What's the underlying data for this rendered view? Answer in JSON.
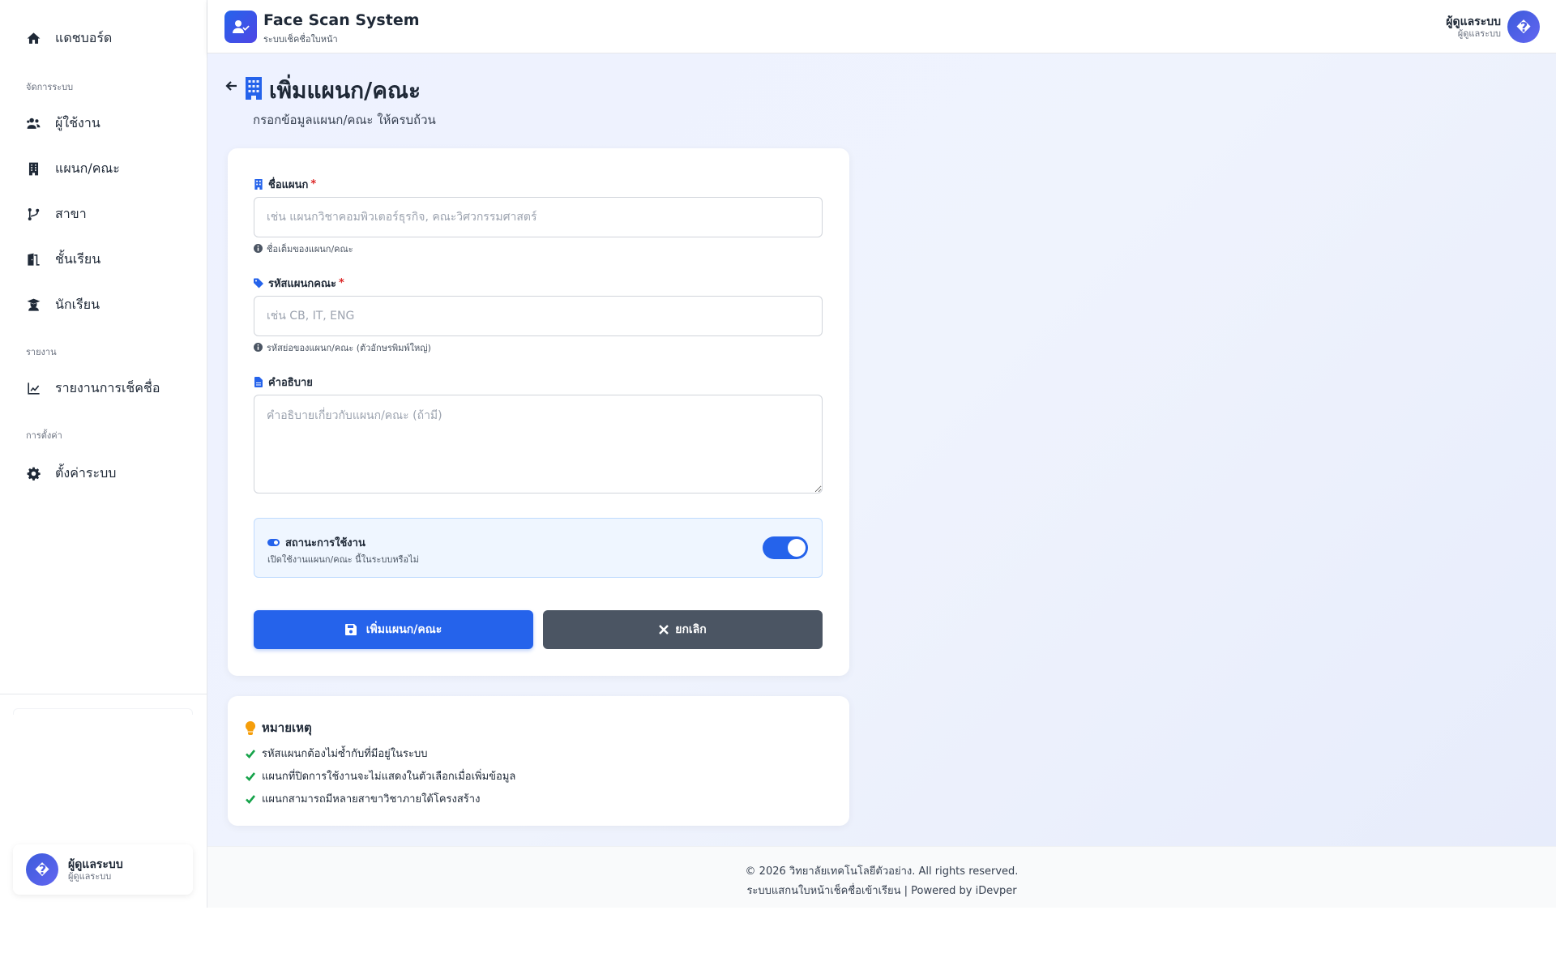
{
  "sidebar": {
    "items": [
      {
        "label": "แดชบอร์ด",
        "icon": "home-icon"
      },
      {
        "label": "ผู้ใช้งาน",
        "icon": "users-icon"
      },
      {
        "label": "แผนก/คณะ",
        "icon": "building-icon"
      },
      {
        "label": "สาขา",
        "icon": "branch-icon"
      },
      {
        "label": "ชั้นเรียน",
        "icon": "door-icon"
      },
      {
        "label": "นักเรียน",
        "icon": "graduate-icon"
      },
      {
        "label": "รายงานการเช็คชื่อ",
        "icon": "chart-line-icon"
      },
      {
        "label": "ตั้งค่าระบบ",
        "icon": "gear-icon"
      }
    ],
    "sections": {
      "manage": "จัดการระบบ",
      "reports": "รายงาน",
      "settings": "การตั้งค่า"
    },
    "user": {
      "avatar": "�",
      "name": "ผู้ดูแลระบบ",
      "role": "ผู้ดูแลระบบ"
    }
  },
  "header": {
    "title": "Face Scan System",
    "subtitle": "ระบบเช็คชื่อใบหน้า",
    "user": {
      "avatar": "�",
      "name": "ผู้ดูแลระบบ",
      "role": "ผู้ดูแลระบบ"
    }
  },
  "page": {
    "title": "เพิ่มแผนก/คณะ",
    "subtitle": "กรอกข้อมูลแผนก/คณะ ให้ครบถ้วน"
  },
  "form": {
    "name": {
      "label": "ชื่อแผนก",
      "required": "*",
      "placeholder": "เช่น แผนกวิชาคอมพิวเตอร์ธุรกิจ, คณะวิศวกรรมศาสตร์",
      "value": "",
      "hint": "ชื่อเต็มของแผนก/คณะ"
    },
    "code": {
      "label": "รหัสแผนกคณะ",
      "required": "*",
      "placeholder": "เช่น CB, IT, ENG",
      "value": "",
      "hint": "รหัสย่อของแผนก/คณะ (ตัวอักษรพิมพ์ใหญ่)"
    },
    "description": {
      "label": "คำอธิบาย",
      "placeholder": "คำอธิบายเกี่ยวกับแผนก/คณะ (ถ้ามี)",
      "value": ""
    },
    "status": {
      "label": "สถานะการใช้งาน",
      "description": "เปิดใช้งานแผนก/คณะ นี้ในระบบหรือไม่",
      "enabled": true
    },
    "submit_label": "เพิ่มแผนก/คณะ",
    "cancel_label": "ยกเลิก"
  },
  "notes": {
    "title": "หมายเหตุ",
    "items": [
      "รหัสแผนกต้องไม่ซ้ำกับที่มีอยู่ในระบบ",
      "แผนกที่ปิดการใช้งานจะไม่แสดงในตัวเลือกเมื่อเพิ่มข้อมูล",
      "แผนกสามารถมีหลายสาขาวิชาภายใต้โครงสร้าง"
    ]
  },
  "footer": {
    "copyright": "© 2026 วิทยาลัยเทคโนโลยีตัวอย่าง. All rights reserved.",
    "powered": "ระบบแสกนใบหน้าเช็คชื่อเข้าเรียน | Powered by iDevper"
  },
  "colors": {
    "accent": "#2563eb",
    "secondary_button": "#4b5563",
    "required": "#dc2626",
    "check": "#16a34a",
    "bulb": "#f59e0b"
  }
}
